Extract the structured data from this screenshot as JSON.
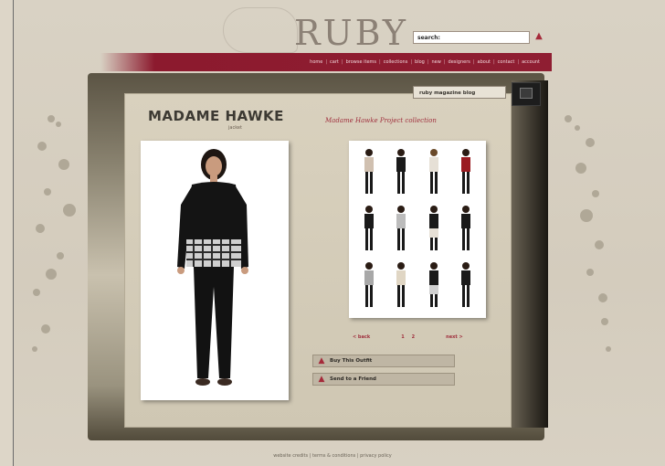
{
  "site": {
    "logo_text": "RUBY",
    "search_label": "search:",
    "search_placeholder": ""
  },
  "nav": {
    "items": [
      "home",
      "cart",
      "browse items",
      "collections",
      "blog",
      "new",
      "designers",
      "about",
      "contact",
      "account"
    ]
  },
  "magazine_tab": {
    "label": "ruby magazine blog"
  },
  "product": {
    "title": "MADAME HAWKE",
    "subtitle": "jacket",
    "collection": "Madame Hawke Project collection"
  },
  "gallery": {
    "thumb_count": 12
  },
  "pager": {
    "prev": "< back",
    "pages": [
      "1",
      "2"
    ],
    "next": "next >"
  },
  "actions": {
    "buy": "Buy This Outfit",
    "send": "Send to a Friend"
  },
  "footer": {
    "text": "website credits | terms & conditions | privacy policy"
  },
  "colors": {
    "accent": "#8f1e32",
    "background": "#ddd6c8"
  }
}
